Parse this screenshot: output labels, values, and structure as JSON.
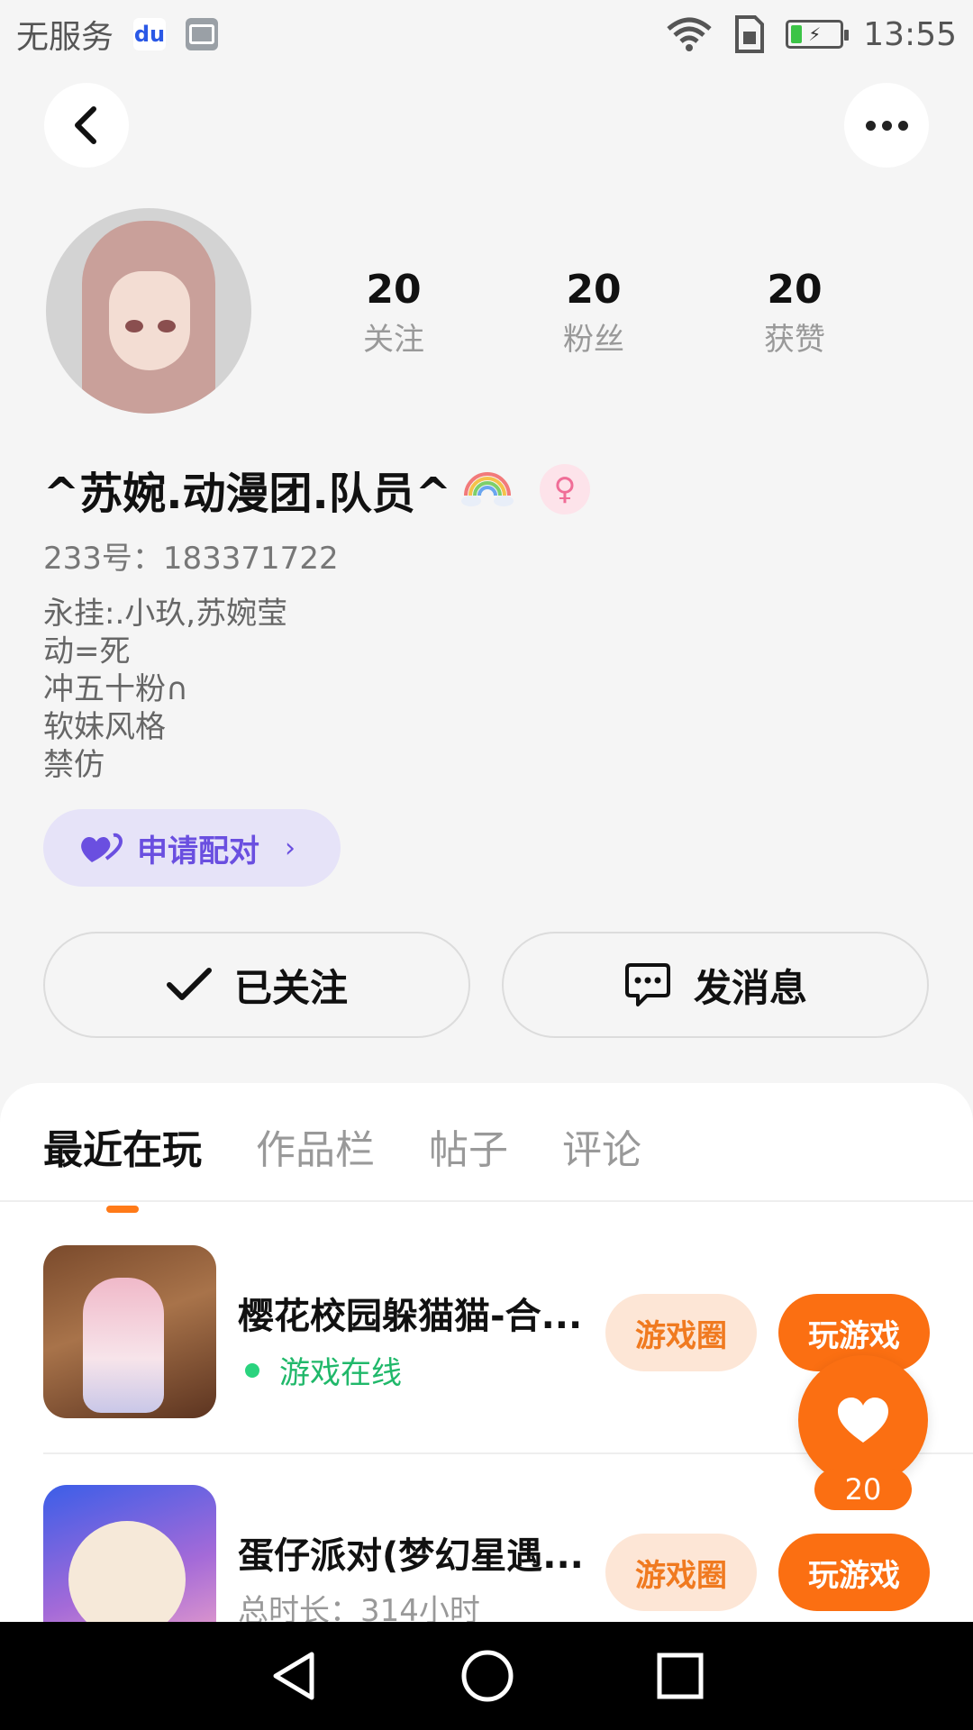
{
  "status_bar": {
    "carrier": "无服务",
    "time": "13:55"
  },
  "profile": {
    "stats": [
      {
        "value": "20",
        "label": "关注"
      },
      {
        "value": "20",
        "label": "粉丝"
      },
      {
        "value": "20",
        "label": "获赞"
      }
    ],
    "name": "^苏婉.动漫团.队员^",
    "uid": "233号：183371722",
    "bio": [
      "永挂:.小玖,苏婉莹",
      "动=死",
      "冲五十粉∩",
      "软妹风格",
      "禁仿"
    ],
    "pair_label": "申请配对",
    "follow_label": "已关注",
    "message_label": "发消息"
  },
  "tabs": [
    {
      "label": "最近在玩",
      "active": true
    },
    {
      "label": "作品栏",
      "active": false
    },
    {
      "label": "帖子",
      "active": false
    },
    {
      "label": "评论",
      "active": false
    }
  ],
  "games": [
    {
      "title": "樱花校园躲猫猫-合...",
      "status": "游戏在线",
      "circle_label": "游戏圈",
      "play_label": "玩游戏"
    },
    {
      "title": "蛋仔派对(梦幻星遇...",
      "subtitle": "总时长：314小时",
      "circle_label": "游戏圈",
      "play_label": "玩游戏"
    }
  ],
  "like_count": "20",
  "colors": {
    "accent": "#fb6f12",
    "online": "#20b86a",
    "pair": "#6a4fe0"
  }
}
